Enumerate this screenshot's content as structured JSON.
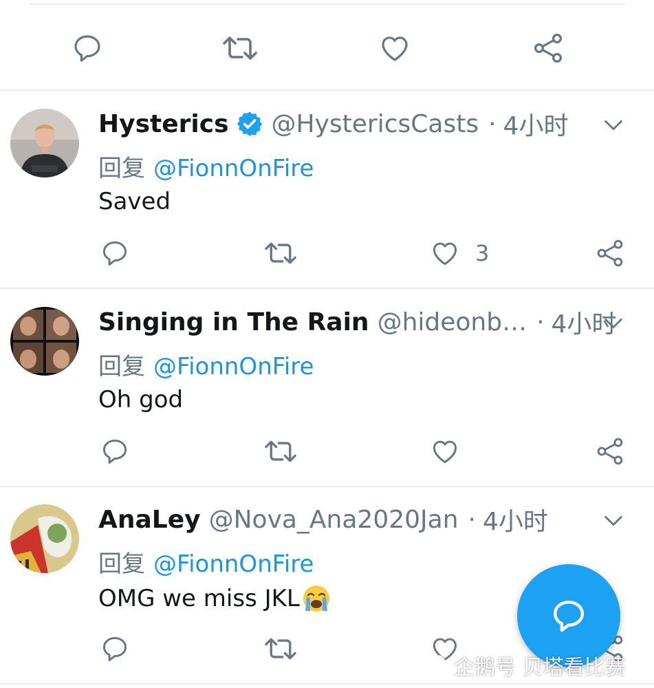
{
  "colors": {
    "accent": "#1b95e0",
    "fab": "#1da1f2",
    "icon_gray": "#657786",
    "verified": "#1da1f2",
    "divider": "#e6ecf0"
  },
  "icons": {
    "reply": "reply-icon",
    "retweet": "retweet-icon",
    "like": "heart-icon",
    "share": "share-icon",
    "more": "chevron-down-icon",
    "verified": "verified-badge-icon",
    "compose": "compose-reply-icon"
  },
  "top_actions": {
    "like_count": ""
  },
  "tweets": [
    {
      "name": "Hysterics",
      "verified": true,
      "handle": "@HystericsCasts",
      "separator": "·",
      "time": "4小时",
      "reply_prefix": "回复",
      "reply_to": "@FionnOnFire",
      "text": "Saved",
      "emoji": "",
      "like_count": "3"
    },
    {
      "name": "Singing in The Rain",
      "verified": false,
      "handle": "@hideonb…",
      "separator": "·",
      "time": "4小时",
      "reply_prefix": "回复",
      "reply_to": "@FionnOnFire",
      "text": "Oh god",
      "emoji": "",
      "like_count": ""
    },
    {
      "name": "AnaLey",
      "verified": false,
      "handle": "@Nova_Ana2020Jan",
      "separator": "·",
      "time": "4小时",
      "reply_prefix": "回复",
      "reply_to": "@FionnOnFire",
      "text": "OMG we miss JKL",
      "emoji": "loudly-crying-face",
      "like_count": ""
    }
  ],
  "watermark": "企鹅号 贝塔看比赛"
}
